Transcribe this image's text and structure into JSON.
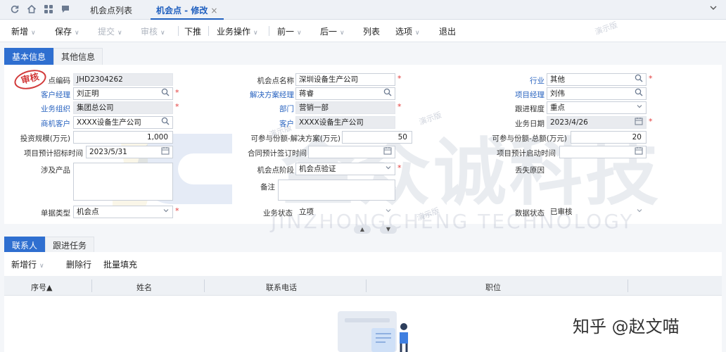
{
  "top_tabs": [
    {
      "label": "机会点列表"
    },
    {
      "label": "机会点 - 修改",
      "close": "×"
    }
  ],
  "toolbar": {
    "new": "新增",
    "save": "保存",
    "submit": "提交",
    "audit": "审核",
    "push_down": "下推",
    "biz_ops": "业务操作",
    "prev": "前一",
    "next": "后一",
    "list": "列表",
    "options": "选项",
    "exit": "退出",
    "caret": "∨"
  },
  "section_tabs": [
    "基本信息",
    "其他信息"
  ],
  "stamp": "审核",
  "form": {
    "code_label": "点编码",
    "code": "JHD2304262",
    "customer_manager_label": "客户经理",
    "customer_manager": "刘正明",
    "biz_org_label": "业务组织",
    "biz_org": "集团总公司",
    "opp_customer_label": "商机客户",
    "opp_customer": "XXXX设备生产公司",
    "invest_label": "投资规模(万元)",
    "invest": "1,000",
    "bid_time_label": "项目预计招标时间",
    "bid_time": "2023/5/31",
    "products_label": "涉及产品",
    "doc_type_label": "单据类型",
    "doc_type": "机会点",
    "opp_name_label": "机会点名称",
    "opp_name": "深圳设备生产公司",
    "solution_mgr_label": "解决方案经理",
    "solution_mgr": "蒋睿",
    "dept_label": "部门",
    "dept": "营销一部",
    "customer_label": "客户",
    "customer": "XXXX设备生产公司",
    "share_solution_label": "可参与份额-解决方案(万元)",
    "share_solution": "50",
    "contract_time_label": "合同预计签订时间",
    "contract_time": "",
    "stage_label": "机会点阶段",
    "stage": "机会点验证",
    "remark_label": "备注",
    "biz_status_label": "业务状态",
    "biz_status": "立项",
    "industry_label": "行业",
    "industry": "其他",
    "project_mgr_label": "项目经理",
    "project_mgr": "刘伟",
    "follow_label": "跟进程度",
    "follow": "重点",
    "biz_date_label": "业务日期",
    "biz_date": "2023/4/26",
    "share_total_label": "可参与份额-总额(万元)",
    "share_total": "20",
    "start_time_label": "项目预计启动时间",
    "start_time": "",
    "lost_reason_label": "丢失原因",
    "data_status_label": "数据状态",
    "data_status": "已审核"
  },
  "contacts": {
    "tabs": [
      "联系人",
      "跟进任务"
    ],
    "toolbar": {
      "add_row": "新增行",
      "delete_row": "删除行",
      "bulk_fill": "批量填充"
    },
    "columns": [
      "序号▲",
      "姓名",
      "联系电话",
      "职位"
    ]
  },
  "watermark": {
    "cn": "金众诚科技",
    "en": "JINZHONGCHENG TECHNOLOGY",
    "small": "演示版"
  },
  "signature": "知乎 @赵文喵",
  "colors": {
    "accent": "#2f6fd0",
    "link": "#2a64c0",
    "required": "#e23b3b"
  }
}
